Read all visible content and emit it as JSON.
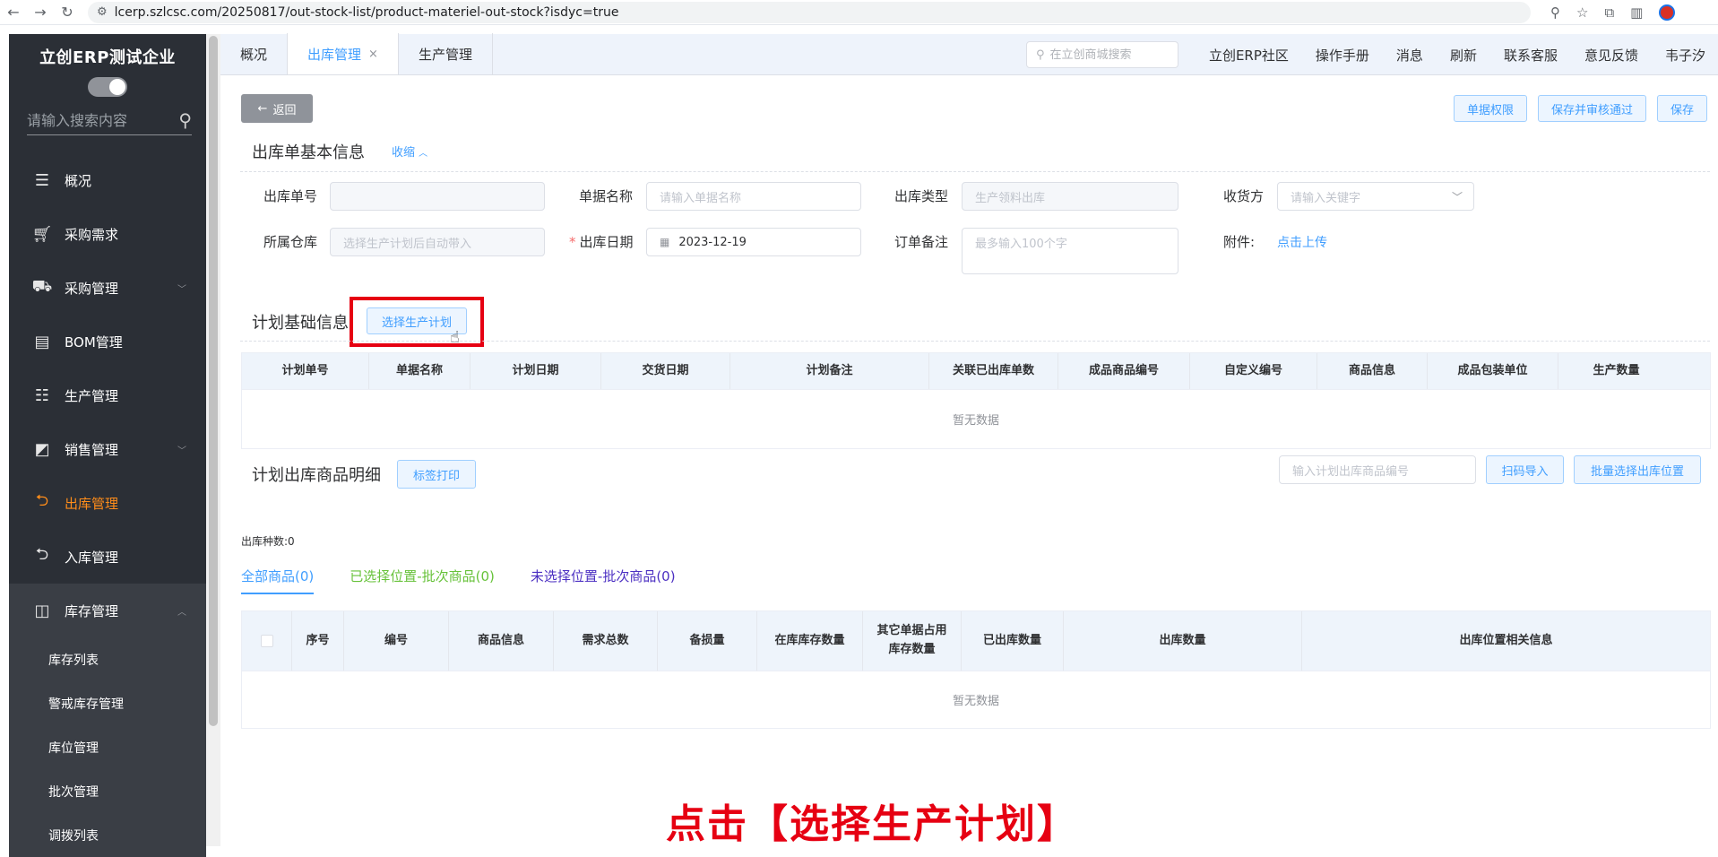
{
  "browser": {
    "url": "lcerp.szlcsc.com/20250817/out-stock-list/product-materiel-out-stock?isdyc=true"
  },
  "sidebar": {
    "company": "立创ERP测试企业",
    "search_placeholder": "请输入搜索内容",
    "items": [
      {
        "label": "概况",
        "icon": "list-icon"
      },
      {
        "label": "采购需求",
        "icon": "cart-icon"
      },
      {
        "label": "采购管理",
        "icon": "truck-icon"
      },
      {
        "label": "BOM管理",
        "icon": "bom-icon"
      },
      {
        "label": "生产管理",
        "icon": "production-icon"
      },
      {
        "label": "销售管理",
        "icon": "sales-icon"
      },
      {
        "label": "出库管理",
        "icon": "outbound-icon"
      },
      {
        "label": "入库管理",
        "icon": "inbound-icon"
      },
      {
        "label": "库存管理",
        "icon": "inventory-icon"
      }
    ],
    "subitems": [
      "库存列表",
      "警戒库存管理",
      "库位管理",
      "批次管理",
      "调拨列表"
    ]
  },
  "tabs": [
    {
      "label": "概况"
    },
    {
      "label": "出库管理",
      "close": "×"
    },
    {
      "label": "生产管理"
    }
  ],
  "topbar": {
    "search_placeholder": "在立创商城搜索",
    "links": [
      "立创ERP社区",
      "操作手册",
      "消息",
      "刷新",
      "联系客服",
      "意见反馈"
    ],
    "user": "韦子汐"
  },
  "actions": {
    "back": "返回",
    "permission": "单据权限",
    "save_approve": "保存并审核通过",
    "save": "保存"
  },
  "basic_info": {
    "title": "出库单基本信息",
    "collapse": "收缩",
    "fields": {
      "order_no_label": "出库单号",
      "doc_name_label": "单据名称",
      "doc_name_placeholder": "请输入单据名称",
      "type_label": "出库类型",
      "type_value": "生产领料出库",
      "receiver_label": "收货方",
      "receiver_placeholder": "请输入关键字",
      "warehouse_label": "所属仓库",
      "warehouse_placeholder": "选择生产计划后自动带入",
      "date_label": "出库日期",
      "date_required": "*",
      "date_value": "2023-12-19",
      "remark_label": "订单备注",
      "remark_placeholder": "最多输入100个字",
      "attachment_label": "附件:",
      "attachment_link": "点击上传"
    }
  },
  "plan_info": {
    "title": "计划基础信息",
    "select_button": "选择生产计划",
    "columns": [
      "计划单号",
      "单据名称",
      "计划日期",
      "交货日期",
      "计划备注",
      "关联已出库单数",
      "成品商品编号",
      "自定义编号",
      "商品信息",
      "成品包装单位",
      "生产数量"
    ],
    "empty": "暂无数据"
  },
  "detail": {
    "title": "计划出库商品明细",
    "label_print": "标签打印",
    "code_placeholder": "输入计划出库商品编号",
    "scan_import": "扫码导入",
    "batch_select": "批量选择出库位置",
    "kind_count": "出库种数:0",
    "filters": [
      "全部商品(0)",
      "已选择位置-批次商品(0)",
      "未选择位置-批次商品(0)"
    ],
    "columns": [
      "序号",
      "编号",
      "商品信息",
      "需求总数",
      "备损量",
      "在库库存数量",
      "其它单据占用库存数量",
      "已出库数量",
      "出库数量",
      "出库位置相关信息"
    ],
    "empty": "暂无数据"
  },
  "caption": "点击【选择生产计划】",
  "colors": {
    "accent": "#409eff",
    "active_menu": "#ff8d1a",
    "highlight": "#e60012",
    "sidebar_bg": "#2b2f36"
  }
}
